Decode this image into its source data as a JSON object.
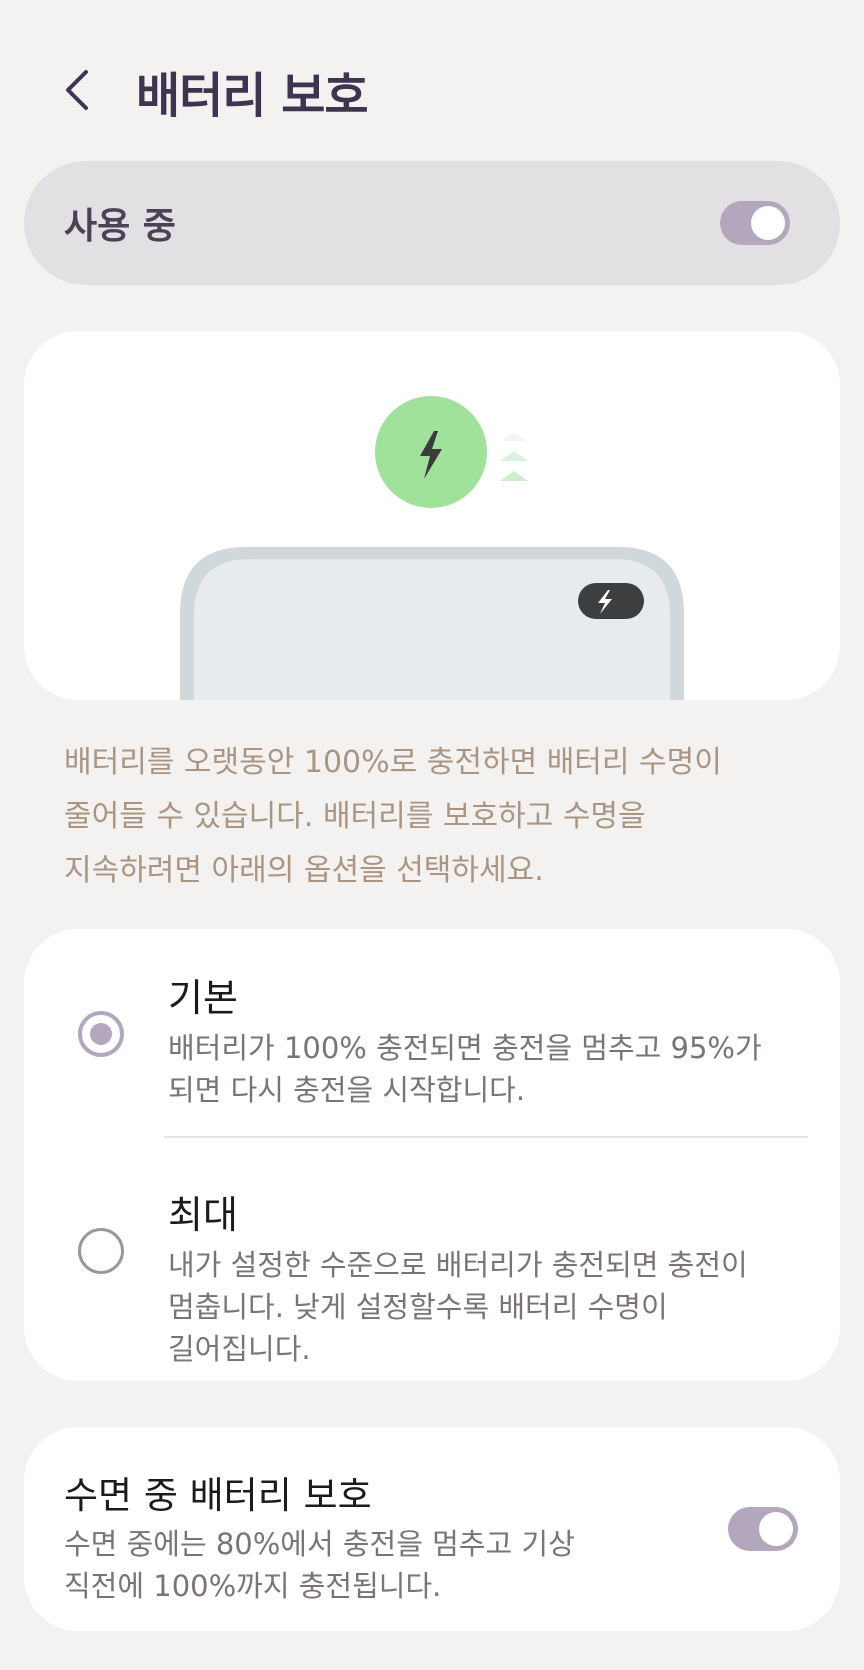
{
  "header": {
    "back_icon": "chevron-left-icon",
    "title": "배터리 보호"
  },
  "master_toggle": {
    "label": "사용 중",
    "on": true
  },
  "illustration": {
    "charge_icon": "lightning-bolt-icon",
    "phone_badge_icon": "lightning-bolt-icon",
    "colors": {
      "circle": "#a0e29c",
      "bolt": "#3a3c3c",
      "phone_frame": "#d1d8dc",
      "phone_screen": "#e8ebee",
      "badge": "#3d3e40",
      "arrows": "#cfeccd"
    }
  },
  "description": {
    "lines": [
      "배터리를 오랫동안 100%로 충전하면 배터리 수명이",
      "줄어들 수 있습니다. 배터리를 보호하고 수명을",
      "지속하려면 아래의 옵션을 선택하세요."
    ]
  },
  "options": [
    {
      "title": "기본",
      "description_lines": [
        "배터리가 100% 충전되면 충전을 멈추고 95%가",
        "되면 다시 충전을 시작합니다."
      ],
      "selected": true
    },
    {
      "title": "최대",
      "description_lines": [
        "내가 설정한 수준으로 배터리가 충전되면 충전이",
        "멈춥니다. 낮게 설정할수록 배터리 수명이",
        "길어집니다."
      ],
      "selected": false
    }
  ],
  "sleep_protection": {
    "title": "수면 중 배터리 보호",
    "description_lines": [
      "수면 중에는 80%에서 충전을 멈추고 기상",
      "직전에 100%까지 충전됩니다."
    ],
    "on": true
  },
  "accent_color": "#b3a7bd"
}
